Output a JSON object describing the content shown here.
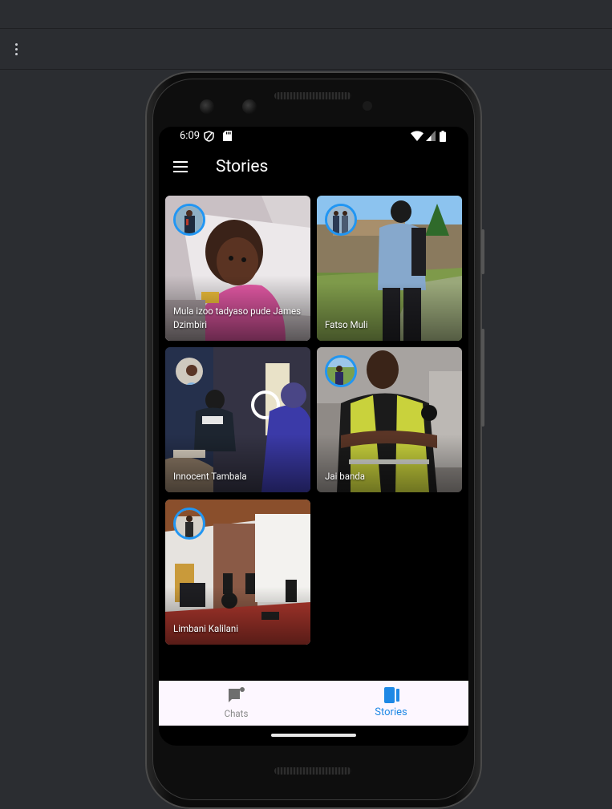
{
  "app": {
    "title": "Stories"
  },
  "status_bar": {
    "time": "6:09"
  },
  "stories": [
    {
      "name": "Mula izoo tadyaso pude James Dzimbiri"
    },
    {
      "name": "Fatso Muli"
    },
    {
      "name": "Innocent Tambala"
    },
    {
      "name": "Jai banda"
    },
    {
      "name": "Limbani Kalilani"
    }
  ],
  "bottom_nav": {
    "items": [
      {
        "label": "Chats",
        "icon": "chat-icon",
        "active": false
      },
      {
        "label": "Stories",
        "icon": "stories-icon",
        "active": true
      }
    ]
  },
  "colors": {
    "accent": "#1e88e5",
    "avatar_ring": "#2196f3",
    "nav_background": "#fdf7ff"
  }
}
